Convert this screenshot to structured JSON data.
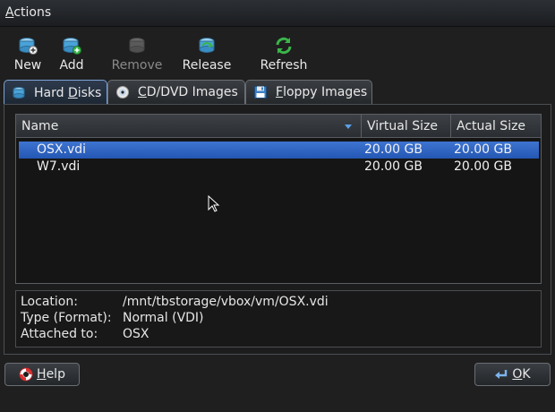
{
  "menubar": {
    "actions_prefix": "A",
    "actions_rest": "ctions"
  },
  "toolbar": {
    "new_label": "New",
    "add_label": "Add",
    "remove_label": "Remove",
    "release_label": "Release",
    "refresh_label": "Refresh"
  },
  "tabs": {
    "hard_disks_pre": "Hard ",
    "hard_disks_u": "D",
    "hard_disks_post": "isks",
    "cddvd_u": "C",
    "cddvd_post": "D/DVD Images",
    "floppy_u": "F",
    "floppy_post": "loppy Images"
  },
  "table": {
    "columns": [
      "Name",
      "Virtual Size",
      "Actual Size"
    ],
    "rows": [
      {
        "name": "OSX.vdi",
        "virtual_size": "20.00 GB",
        "actual_size": "20.00 GB",
        "selected": true
      },
      {
        "name": "W7.vdi",
        "virtual_size": "20.00 GB",
        "actual_size": "20.00 GB",
        "selected": false
      }
    ]
  },
  "details": {
    "location_label": "Location:",
    "location_value": "/mnt/tbstorage/vbox/vm/OSX.vdi",
    "type_label": "Type (Format):",
    "type_value": "Normal (VDI)",
    "attached_label": "Attached to:",
    "attached_value": "OSX"
  },
  "buttons": {
    "help_u": "H",
    "help_rest": "elp",
    "ok_u": "O",
    "ok_rest": "K"
  },
  "colors": {
    "selection": "#2f64c4",
    "background": "#1f1f1f",
    "accent_green": "#3bb54a"
  }
}
